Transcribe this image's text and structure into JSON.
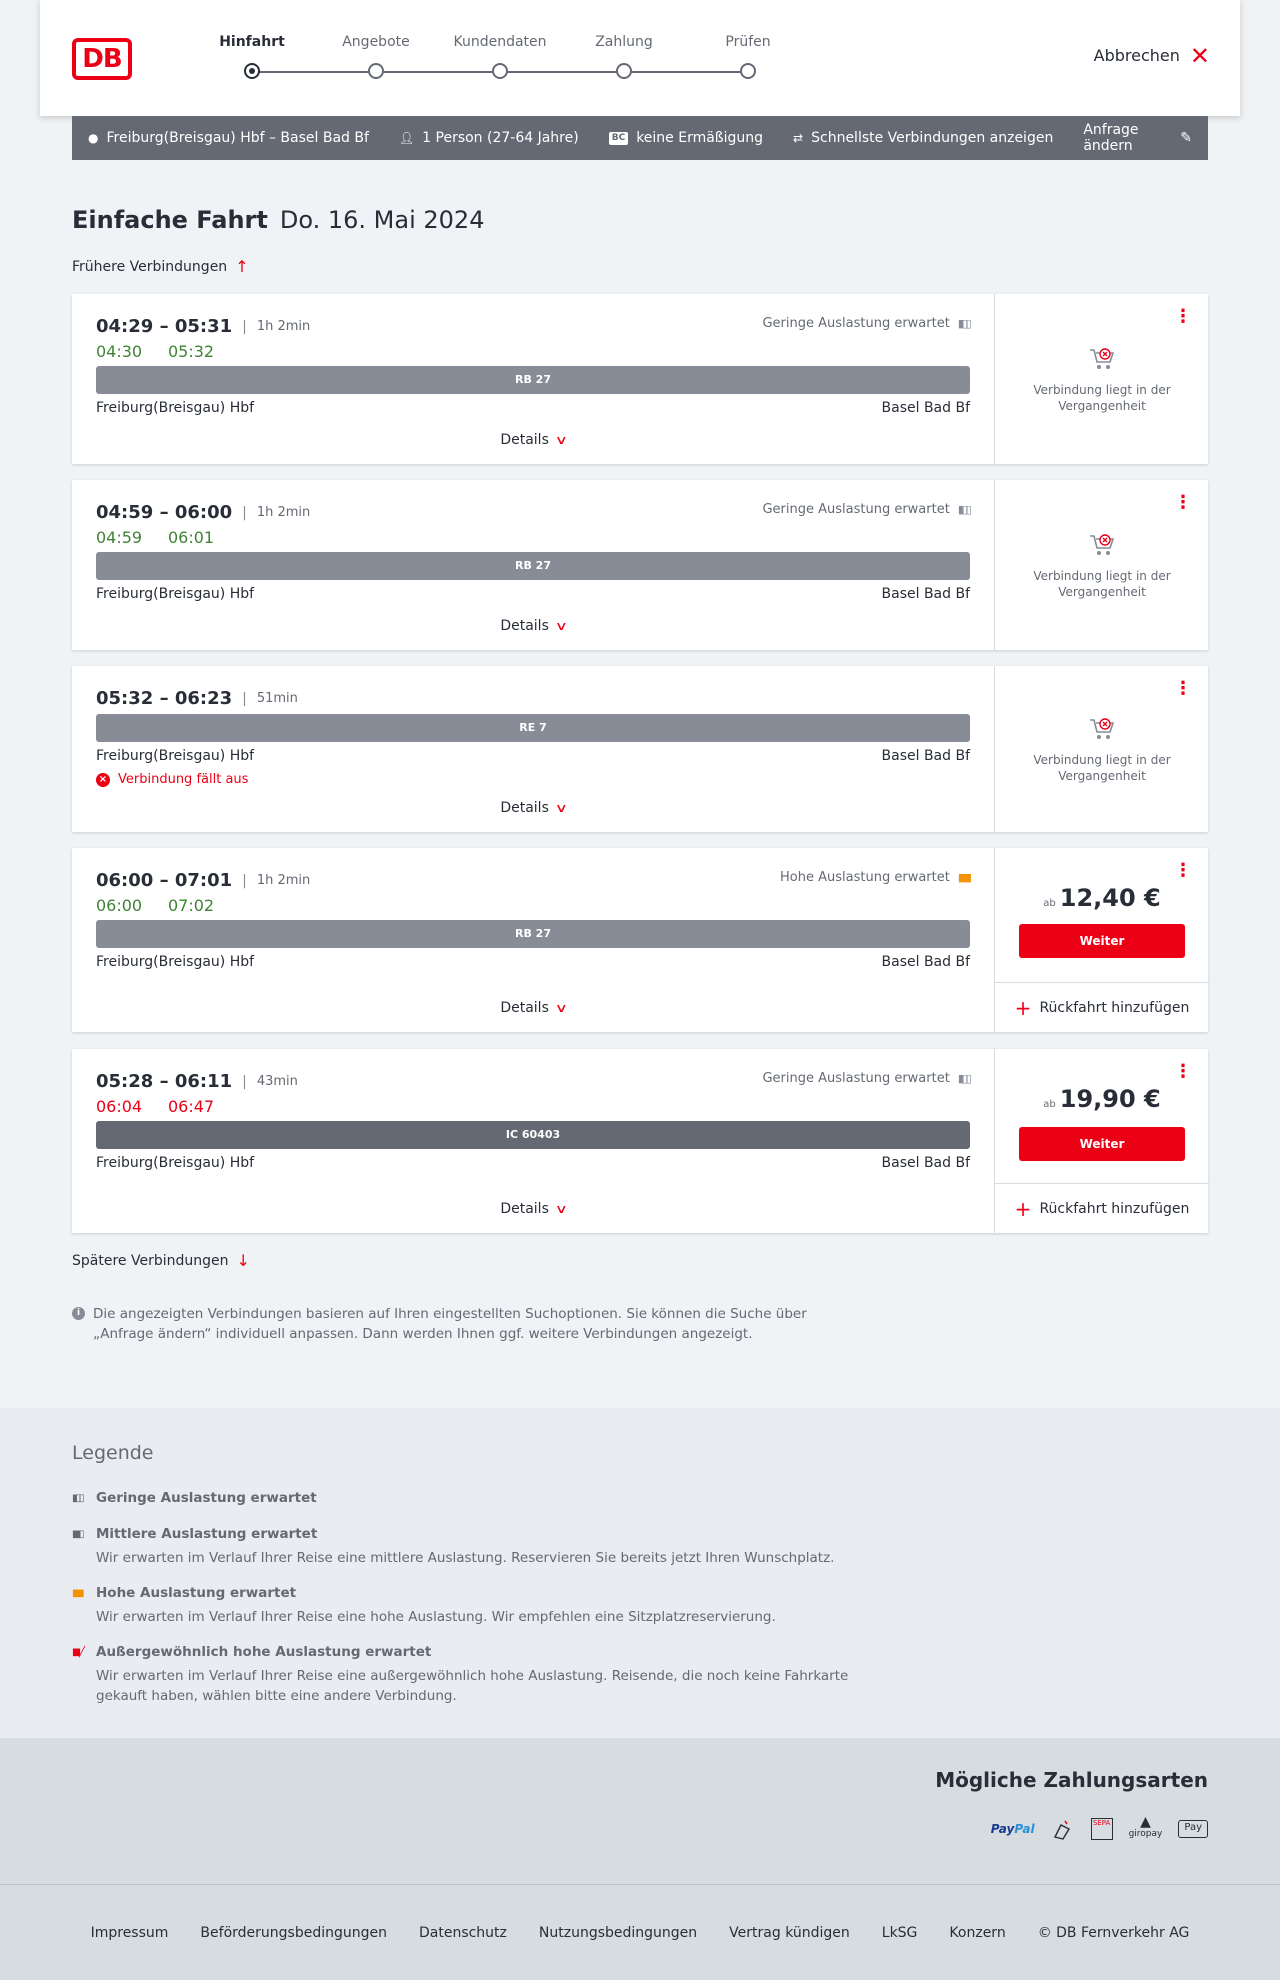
{
  "header": {
    "logo": "DB",
    "steps": [
      "Hinfahrt",
      "Angebote",
      "Kundendaten",
      "Zahlung",
      "Prüfen"
    ],
    "cancel_label": "Abbrechen"
  },
  "searchbar": {
    "route": "Freiburg(Breisgau) Hbf – Basel Bad Bf",
    "passengers": "1 Person (27-64 Jahre)",
    "discount_badge": "BC",
    "discount": "keine Ermäßigung",
    "fastest": "Schnellste Verbindungen anzeigen",
    "edit": "Anfrage ändern"
  },
  "title": {
    "main": "Einfache Fahrt",
    "date": "Do. 16. Mai 2024"
  },
  "earlier_label": "Frühere Verbindungen",
  "later_label": "Spätere Verbindungen",
  "connections": [
    {
      "times": "04:29 – 05:31",
      "duration": "1h 2min",
      "rt_dep": "04:30",
      "rt_arr": "05:32",
      "rt_status": "ontime",
      "load": "Geringe Auslastung erwartet",
      "load_level": "low",
      "train": "RB 27",
      "from": "Freiburg(Breisgau) Hbf",
      "to": "Basel Bad Bf",
      "details": "Details",
      "past": "Verbindung liegt in der Vergangenheit"
    },
    {
      "times": "04:59 – 06:00",
      "duration": "1h 2min",
      "rt_dep": "04:59",
      "rt_arr": "06:01",
      "rt_status": "ontime",
      "load": "Geringe Auslastung erwartet",
      "load_level": "low",
      "train": "RB 27",
      "from": "Freiburg(Breisgau) Hbf",
      "to": "Basel Bad Bf",
      "details": "Details",
      "past": "Verbindung liegt in der Vergangenheit"
    },
    {
      "times": "05:32 – 06:23",
      "duration": "51min",
      "train": "RE 7",
      "from": "Freiburg(Breisgau) Hbf",
      "to": "Basel Bad Bf",
      "cancelled": "Verbindung fällt aus",
      "details": "Details",
      "past": "Verbindung liegt in der Vergangenheit"
    },
    {
      "times": "06:00 – 07:01",
      "duration": "1h 2min",
      "rt_dep": "06:00",
      "rt_arr": "07:02",
      "rt_status": "ontime",
      "load": "Hohe Auslastung erwartet",
      "load_level": "high",
      "train": "RB 27",
      "from": "Freiburg(Breisgau) Hbf",
      "to": "Basel Bad Bf",
      "details": "Details",
      "price_prefix": "ab",
      "price": "12,40 €",
      "button": "Weiter",
      "return_add": "Rückfahrt hinzufügen"
    },
    {
      "times": "05:28 – 06:11",
      "duration": "43min",
      "rt_dep": "06:04",
      "rt_arr": "06:47",
      "rt_status": "late",
      "load": "Geringe Auslastung erwartet",
      "load_level": "low",
      "train": "IC 60403",
      "from": "Freiburg(Breisgau) Hbf",
      "to": "Basel Bad Bf",
      "details": "Details",
      "price_prefix": "ab",
      "price": "19,90 €",
      "button": "Weiter",
      "return_add": "Rückfahrt hinzufügen"
    }
  ],
  "info_text": "Die angezeigten Verbindungen basieren auf Ihren eingestellten Suchoptionen. Sie können die Suche über „Anfrage ändern“ individuell anpassen. Dann werden Ihnen ggf. weitere Verbindungen angezeigt.",
  "legend": {
    "title": "Legende",
    "items": [
      {
        "title": "Geringe Auslastung erwartet",
        "desc": ""
      },
      {
        "title": "Mittlere Auslastung erwartet",
        "desc": "Wir erwarten im Verlauf Ihrer Reise eine mittlere Auslastung. Reservieren Sie bereits jetzt Ihren Wunschplatz."
      },
      {
        "title": "Hohe Auslastung erwartet",
        "desc": "Wir erwarten im Verlauf Ihrer Reise eine hohe Auslastung. Wir empfehlen eine Sitzplatzreservierung."
      },
      {
        "title": "Außergewöhnlich hohe Auslastung erwartet",
        "desc": "Wir erwarten im Verlauf Ihrer Reise eine außergewöhnlich hohe Auslastung. Reisende, die noch keine Fahrkarte gekauft haben, wählen bitte eine andere Verbindung."
      }
    ]
  },
  "payment": {
    "title": "Mögliche Zahlungsarten",
    "paypal_a": "Pay",
    "paypal_b": "Pal",
    "sepa": "SEPA",
    "giropay": "giropay",
    "applepay": "Pay"
  },
  "footer": [
    "Impressum",
    "Beförderungsbedingungen",
    "Datenschutz",
    "Nutzungsbedingungen",
    "Vertrag kündigen",
    "LkSG",
    "Konzern",
    "© DB Fernverkehr AG"
  ],
  "colors": {
    "brand_red": "#ec0016",
    "ontime_green": "#408335",
    "high_load_orange": "#f39200",
    "bar_gray": "#646973"
  }
}
